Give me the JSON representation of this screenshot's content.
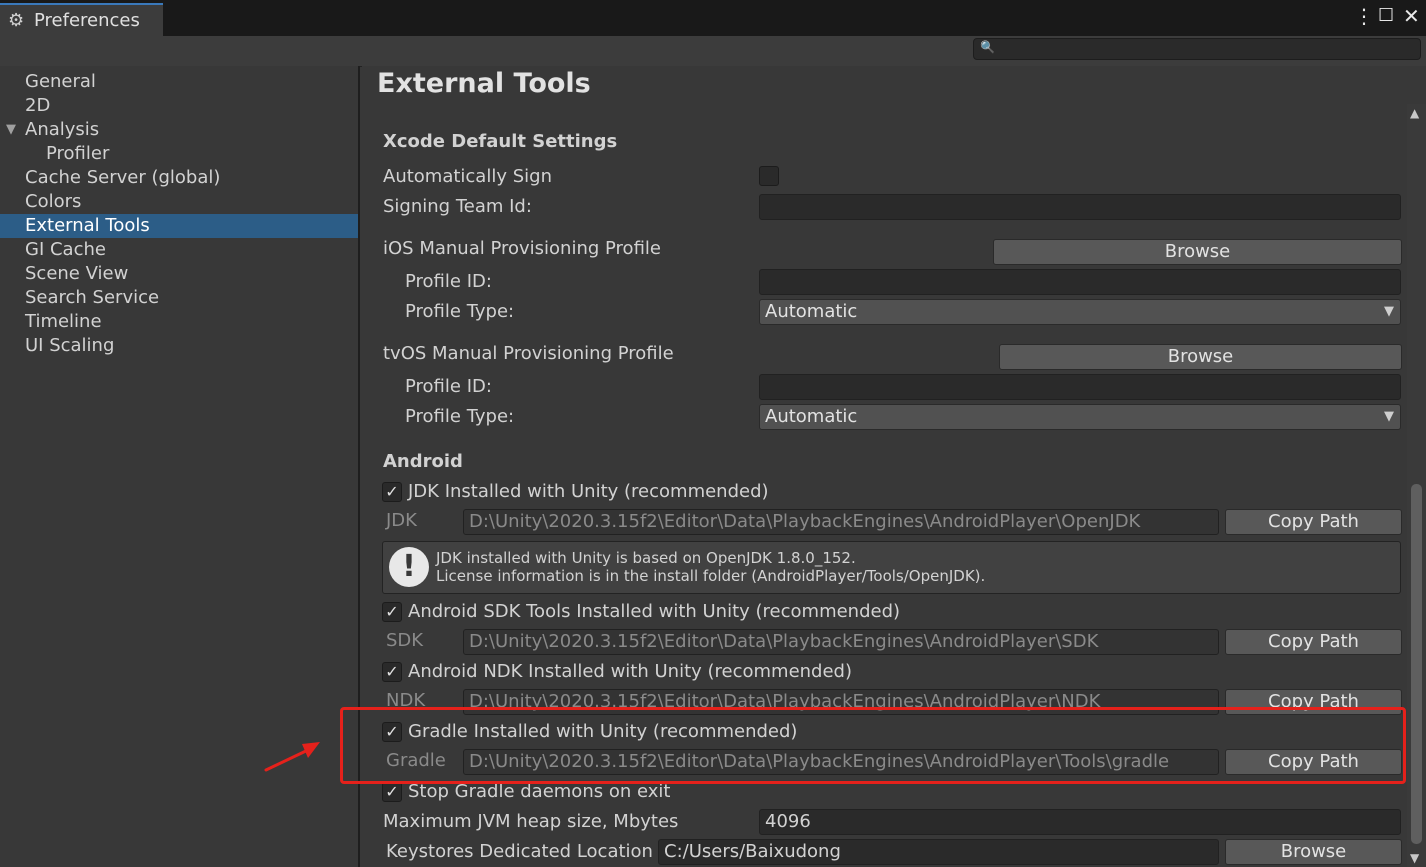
{
  "window": {
    "tab_title": "Preferences",
    "tab_icon": "gear-icon",
    "menu_icon": "kebab-menu-icon",
    "maximize_icon": "maximize-icon",
    "close_icon": "close-icon"
  },
  "search": {
    "placeholder": "",
    "icon": "search-icon"
  },
  "sidebar": {
    "items": [
      {
        "label": "General"
      },
      {
        "label": "2D"
      },
      {
        "label": "Analysis"
      },
      {
        "label": "Profiler"
      },
      {
        "label": "Cache Server (global)"
      },
      {
        "label": "Colors"
      },
      {
        "label": "External Tools"
      },
      {
        "label": "GI Cache"
      },
      {
        "label": "Scene View"
      },
      {
        "label": "Search Service"
      },
      {
        "label": "Timeline"
      },
      {
        "label": "UI Scaling"
      }
    ],
    "selected": "External Tools"
  },
  "main": {
    "title": "External Tools",
    "xcode": {
      "header": "Xcode Default Settings",
      "auto_sign_label": "Automatically Sign",
      "auto_sign_checked": false,
      "signing_team_label": "Signing Team Id:",
      "signing_team_value": "",
      "ios_profile_label": "iOS Manual Provisioning Profile",
      "ios_browse": "Browse",
      "ios_profile_id_label": "Profile ID:",
      "ios_profile_id_value": "",
      "ios_profile_type_label": "Profile Type:",
      "ios_profile_type_value": "Automatic",
      "tvos_profile_label": "tvOS Manual Provisioning Profile",
      "tvos_browse": "Browse",
      "tvos_profile_id_label": "Profile ID:",
      "tvos_profile_id_value": "",
      "tvos_profile_type_label": "Profile Type:",
      "tvos_profile_type_value": "Automatic"
    },
    "android": {
      "header": "Android",
      "jdk_check_label": "JDK Installed with Unity (recommended)",
      "jdk_label": "JDK",
      "jdk_path": "D:\\Unity\\2020.3.15f2\\Editor\\Data\\PlaybackEngines\\AndroidPlayer\\OpenJDK",
      "jdk_copy": "Copy Path",
      "jdk_info_line1": "JDK installed with Unity is based on OpenJDK 1.8.0_152.",
      "jdk_info_line2": "License information is in the install folder (AndroidPlayer/Tools/OpenJDK).",
      "sdk_check_label": "Android SDK Tools Installed with Unity (recommended)",
      "sdk_label": "SDK",
      "sdk_path": "D:\\Unity\\2020.3.15f2\\Editor\\Data\\PlaybackEngines\\AndroidPlayer\\SDK",
      "sdk_copy": "Copy Path",
      "ndk_check_label": "Android NDK Installed with Unity (recommended)",
      "ndk_label": "NDK",
      "ndk_path": "D:\\Unity\\2020.3.15f2\\Editor\\Data\\PlaybackEngines\\AndroidPlayer\\NDK",
      "ndk_copy": "Copy Path",
      "gradle_check_label": "Gradle Installed with Unity (recommended)",
      "gradle_label": "Gradle",
      "gradle_path": "D:\\Unity\\2020.3.15f2\\Editor\\Data\\PlaybackEngines\\AndroidPlayer\\Tools\\gradle",
      "gradle_copy": "Copy Path",
      "stop_gradle_label": "Stop Gradle daemons on exit",
      "jvm_label": "Maximum JVM heap size, Mbytes",
      "jvm_value": "4096",
      "keystore_label": "Keystores Dedicated Location",
      "keystore_value": "C:/Users/Baixudong",
      "keystore_browse": "Browse"
    }
  },
  "colors": {
    "accent": "#2c5d87",
    "highlight_box": "#e5211b"
  }
}
